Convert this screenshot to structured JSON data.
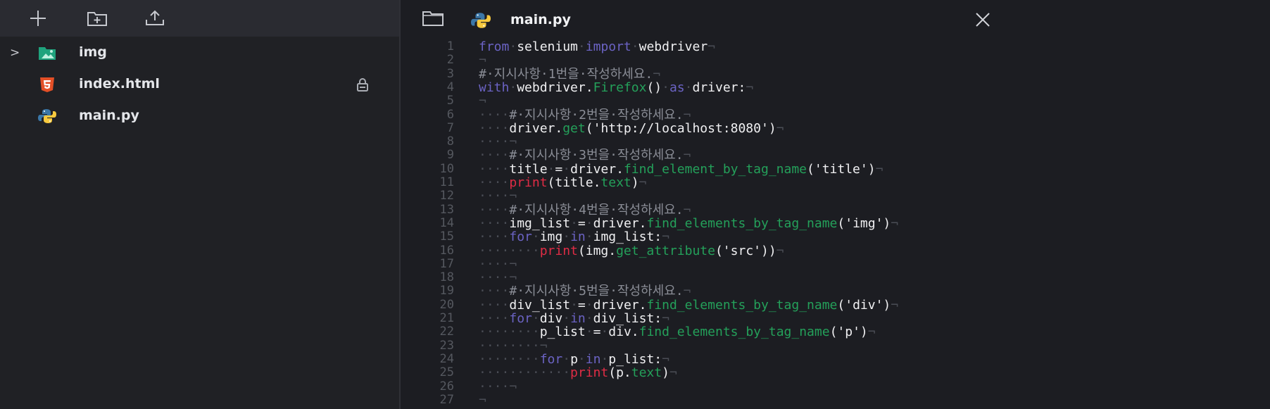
{
  "sidebar": {
    "toolbar": {
      "new_file_icon": "plus-icon",
      "new_folder_icon": "folder-plus-icon",
      "upload_icon": "upload-icon"
    },
    "tree": [
      {
        "label": "img",
        "type": "folder",
        "icon": "image-folder-icon",
        "expanded": false
      },
      {
        "label": "index.html",
        "type": "file",
        "icon": "html5-icon",
        "locked": true
      },
      {
        "label": "main.py",
        "type": "file",
        "icon": "python-icon"
      }
    ]
  },
  "editor": {
    "tab": {
      "label": "main.py",
      "icon": "python-icon"
    },
    "lines": [
      [
        [
          "kw",
          "from"
        ],
        [
          "ws",
          "·"
        ],
        [
          "tx",
          "selenium"
        ],
        [
          "ws",
          "·"
        ],
        [
          "kw",
          "import"
        ],
        [
          "ws",
          "·"
        ],
        [
          "tx",
          "webdriver"
        ],
        [
          "ws",
          "¬"
        ]
      ],
      [
        [
          "ws",
          "¬"
        ]
      ],
      [
        [
          "cm",
          "#·지시사항·1번을·작성하세요."
        ],
        [
          "ws",
          "¬"
        ]
      ],
      [
        [
          "kw",
          "with"
        ],
        [
          "ws",
          "·"
        ],
        [
          "tx",
          "webdriver."
        ],
        [
          "fn",
          "Firefox"
        ],
        [
          "tx",
          "()"
        ],
        [
          "ws",
          "·"
        ],
        [
          "kw",
          "as"
        ],
        [
          "ws",
          "·"
        ],
        [
          "tx",
          "driver:"
        ],
        [
          "ws",
          "¬"
        ]
      ],
      [
        [
          "ws",
          "¬"
        ]
      ],
      [
        [
          "ws",
          "····"
        ],
        [
          "cm",
          "#·지시사항·2번을·작성하세요."
        ],
        [
          "ws",
          "¬"
        ]
      ],
      [
        [
          "ws",
          "····"
        ],
        [
          "tx",
          "driver."
        ],
        [
          "fn",
          "get"
        ],
        [
          "tx",
          "('http://localhost:8080')"
        ],
        [
          "ws",
          "¬"
        ]
      ],
      [
        [
          "ws",
          "····¬"
        ]
      ],
      [
        [
          "ws",
          "····"
        ],
        [
          "cm",
          "#·지시사항·3번을·작성하세요."
        ],
        [
          "ws",
          "¬"
        ]
      ],
      [
        [
          "ws",
          "····"
        ],
        [
          "tx",
          "title"
        ],
        [
          "ws",
          "·"
        ],
        [
          "tx",
          "="
        ],
        [
          "ws",
          "·"
        ],
        [
          "tx",
          "driver."
        ],
        [
          "fn",
          "find_element_by_tag_name"
        ],
        [
          "tx",
          "('title')"
        ],
        [
          "ws",
          "¬"
        ]
      ],
      [
        [
          "ws",
          "····"
        ],
        [
          "bi",
          "print"
        ],
        [
          "tx",
          "(title."
        ],
        [
          "fn",
          "text"
        ],
        [
          "tx",
          ")"
        ],
        [
          "ws",
          "¬"
        ]
      ],
      [
        [
          "ws",
          "····¬"
        ]
      ],
      [
        [
          "ws",
          "····"
        ],
        [
          "cm",
          "#·지시사항·4번을·작성하세요."
        ],
        [
          "ws",
          "¬"
        ]
      ],
      [
        [
          "ws",
          "····"
        ],
        [
          "tx",
          "img_list"
        ],
        [
          "ws",
          "·"
        ],
        [
          "tx",
          "="
        ],
        [
          "ws",
          "·"
        ],
        [
          "tx",
          "driver."
        ],
        [
          "fn",
          "find_elements_by_tag_name"
        ],
        [
          "tx",
          "('img')"
        ],
        [
          "ws",
          "¬"
        ]
      ],
      [
        [
          "ws",
          "····"
        ],
        [
          "kw",
          "for"
        ],
        [
          "ws",
          "·"
        ],
        [
          "tx",
          "img"
        ],
        [
          "ws",
          "·"
        ],
        [
          "kw",
          "in"
        ],
        [
          "ws",
          "·"
        ],
        [
          "tx",
          "img_list:"
        ],
        [
          "ws",
          "¬"
        ]
      ],
      [
        [
          "ws",
          "········"
        ],
        [
          "bi",
          "print"
        ],
        [
          "tx",
          "(img."
        ],
        [
          "fn",
          "get_attribute"
        ],
        [
          "tx",
          "('src'))"
        ],
        [
          "ws",
          "¬"
        ]
      ],
      [
        [
          "ws",
          "····¬"
        ]
      ],
      [
        [
          "ws",
          "····¬"
        ]
      ],
      [
        [
          "ws",
          "····"
        ],
        [
          "cm",
          "#·지시사항·5번을·작성하세요."
        ],
        [
          "ws",
          "¬"
        ]
      ],
      [
        [
          "ws",
          "····"
        ],
        [
          "tx",
          "div_list"
        ],
        [
          "ws",
          "·"
        ],
        [
          "tx",
          "="
        ],
        [
          "ws",
          "·"
        ],
        [
          "tx",
          "driver."
        ],
        [
          "fn",
          "find_elements_by_tag_name"
        ],
        [
          "tx",
          "('div')"
        ],
        [
          "ws",
          "¬"
        ]
      ],
      [
        [
          "ws",
          "····"
        ],
        [
          "kw",
          "for"
        ],
        [
          "ws",
          "·"
        ],
        [
          "tx",
          "div"
        ],
        [
          "ws",
          "·"
        ],
        [
          "kw",
          "in"
        ],
        [
          "ws",
          "·"
        ],
        [
          "tx",
          "div_list:"
        ],
        [
          "ws",
          "¬"
        ]
      ],
      [
        [
          "ws",
          "········"
        ],
        [
          "tx",
          "p_list"
        ],
        [
          "ws",
          "·"
        ],
        [
          "tx",
          "="
        ],
        [
          "ws",
          "·"
        ],
        [
          "tx",
          "div."
        ],
        [
          "fn",
          "find_elements_by_tag_name"
        ],
        [
          "tx",
          "('p')"
        ],
        [
          "ws",
          "¬"
        ]
      ],
      [
        [
          "ws",
          "········¬"
        ]
      ],
      [
        [
          "ws",
          "········"
        ],
        [
          "kw",
          "for"
        ],
        [
          "ws",
          "·"
        ],
        [
          "tx",
          "p"
        ],
        [
          "ws",
          "·"
        ],
        [
          "kw",
          "in"
        ],
        [
          "ws",
          "·"
        ],
        [
          "tx",
          "p_list:"
        ],
        [
          "ws",
          "¬"
        ]
      ],
      [
        [
          "ws",
          "············"
        ],
        [
          "bi",
          "print"
        ],
        [
          "tx",
          "(p."
        ],
        [
          "fn",
          "text"
        ],
        [
          "tx",
          ")"
        ],
        [
          "ws",
          "¬"
        ]
      ],
      [
        [
          "ws",
          "····¬"
        ]
      ],
      [
        [
          "ws",
          "¬"
        ]
      ]
    ]
  },
  "colors": {
    "keyword": "#6b63c4",
    "function": "#24a05a",
    "builtin": "#e02c45",
    "comment": "#8a8d96",
    "whitespace": "#4a4d55"
  }
}
